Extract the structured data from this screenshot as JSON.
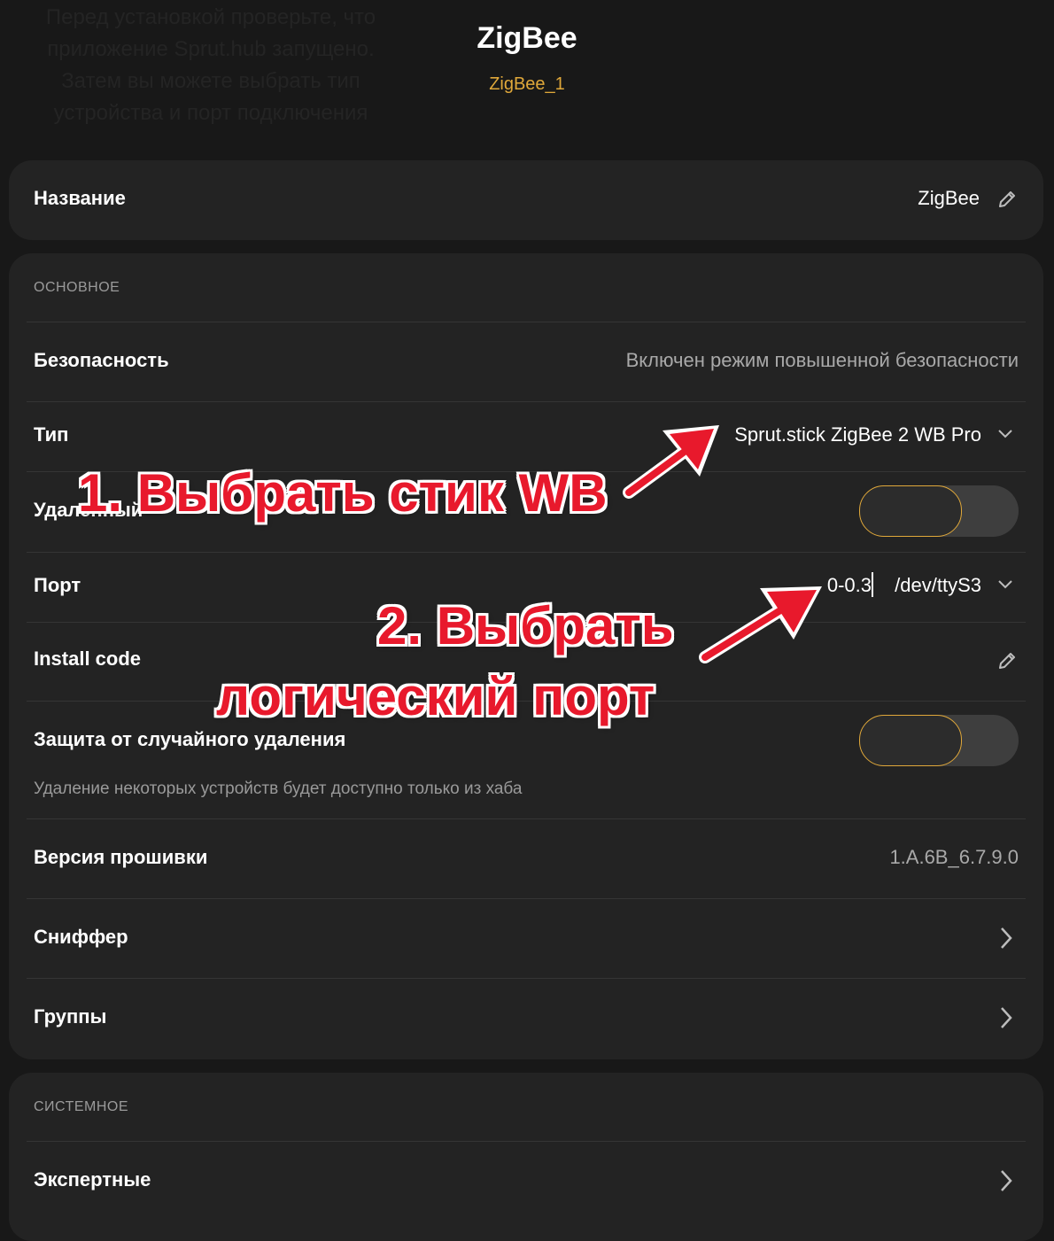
{
  "header": {
    "bg_text": "Перед установкой проверьте, что\nприложение Sprut.hub запущено.\nЗатем вы можете выбрать тип\nустройства и порт подключения",
    "title": "ZigBee",
    "subtitle": "ZigBee_1"
  },
  "name_card": {
    "label": "Название",
    "value": "ZigBee"
  },
  "main_card": {
    "section": "ОСНОВНОЕ",
    "security": {
      "label": "Безопасность",
      "value": "Включен режим повышенной безопасности"
    },
    "type": {
      "label": "Тип",
      "value": "Sprut.stick ZigBee 2 WB Pro"
    },
    "remote": {
      "label": "Удаленный",
      "enabled": true
    },
    "port": {
      "label": "Порт",
      "value_a": "0-0.3",
      "value_b": "/dev/ttyS3"
    },
    "install_code": {
      "label": "Install code"
    },
    "protection": {
      "label": "Защита от случайного удаления",
      "hint": "Удаление некоторых устройств будет доступно только из хаба",
      "enabled": true
    },
    "firmware": {
      "label": "Версия прошивки",
      "value": "1.A.6B_6.7.9.0"
    },
    "sniffer": {
      "label": "Сниффер"
    },
    "groups": {
      "label": "Группы"
    }
  },
  "system_card": {
    "section": "СИСТЕМНОЕ",
    "expert": {
      "label": "Экспертные"
    }
  },
  "annotations": {
    "step1": "1. Выбрать стик WB",
    "step2_line1": "2. Выбрать",
    "step2_line2": "логический порт"
  },
  "colors": {
    "accent": "#e0a83a",
    "background": "#181818",
    "card": "#232323",
    "annotation": "#e8192c"
  }
}
